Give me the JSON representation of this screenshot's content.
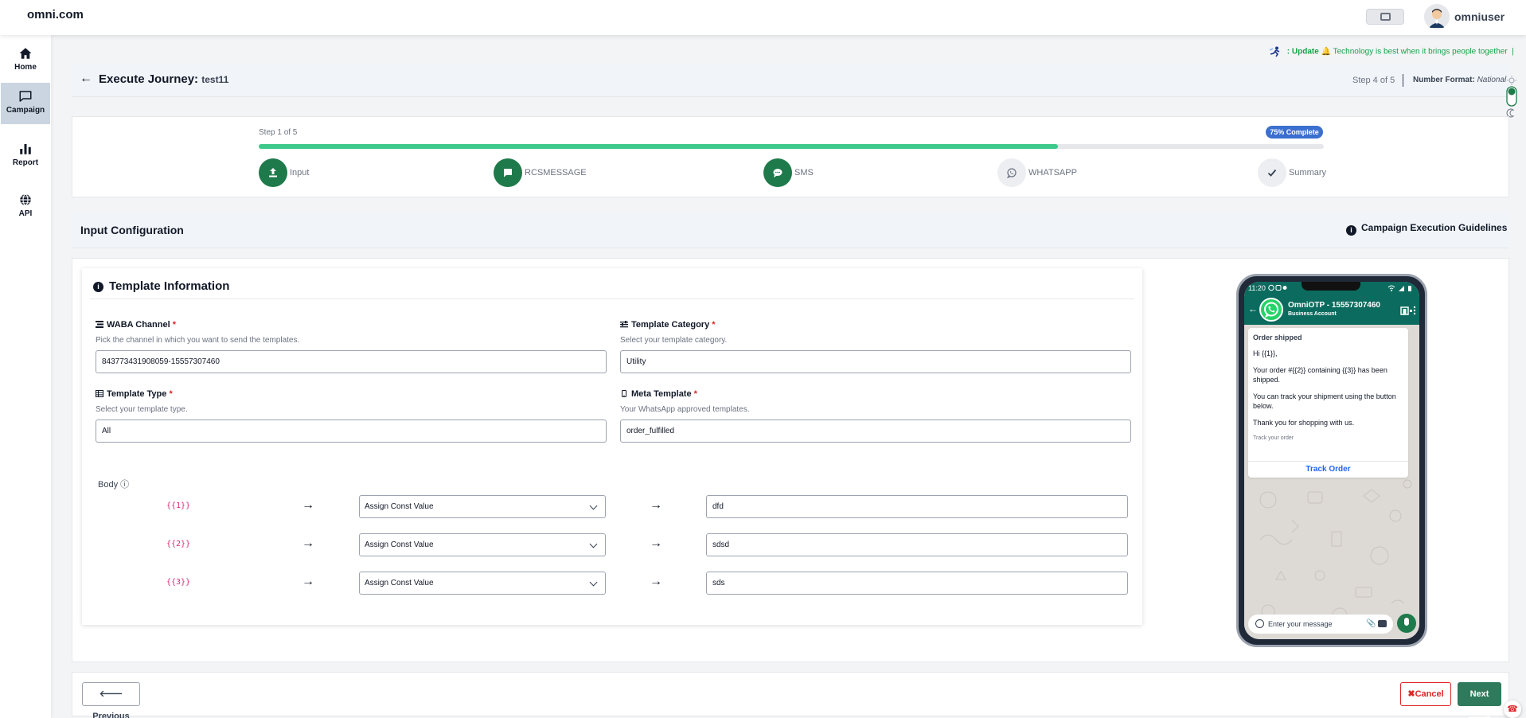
{
  "topbar": {
    "brand": "omni.com",
    "username": "omniuser"
  },
  "sidebar": {
    "items": [
      {
        "label": "Home",
        "icon": "home-icon"
      },
      {
        "label": "Campaign",
        "icon": "chat-icon",
        "active": true
      },
      {
        "label": "Report",
        "icon": "bar-chart-icon"
      },
      {
        "label": "API",
        "icon": "globe-icon"
      }
    ]
  },
  "tagline": {
    "update": ": Update",
    "text": "Technology is best when it brings people together"
  },
  "header": {
    "title": "Execute Journey:",
    "journey_name": "test11",
    "step_of": "Step 4 of 5",
    "number_format_label": "Number Format:",
    "number_format_value": "National"
  },
  "stepper": {
    "step_label": "Step 1 of 5",
    "percent_label": "75% Complete",
    "progress": 0.75,
    "steps": [
      {
        "label": "Input",
        "done": true
      },
      {
        "label": "RCSMESSAGE",
        "done": true
      },
      {
        "label": "SMS",
        "done": true
      },
      {
        "label": "WHATSAPP",
        "done": false
      },
      {
        "label": "Summary",
        "done": false
      }
    ]
  },
  "config": {
    "title": "Input Configuration",
    "guidelines": "Campaign Execution Guidelines"
  },
  "template": {
    "title": "Template Information",
    "fields": {
      "waba": {
        "label": "WABA Channel",
        "required": "*",
        "hint": "Pick the channel in which you want to send the templates.",
        "value": "843773431908059-15557307460"
      },
      "category": {
        "label": "Template Category",
        "required": "*",
        "hint": "Select your template category.",
        "value": "Utility"
      },
      "type": {
        "label": "Template Type",
        "required": "*",
        "hint": "Select your template type.",
        "value": "All"
      },
      "meta": {
        "label": "Meta Template",
        "required": "*",
        "hint": "Your WhatsApp approved templates.",
        "value": "order_fulfilled"
      }
    },
    "body_label": "Body ⓘ",
    "arrow": "→",
    "variables": [
      {
        "token": "{{1}}",
        "mode": "Assign Const Value",
        "value": "dfd"
      },
      {
        "token": "{{2}}",
        "mode": "Assign Const Value",
        "value": "sdsd"
      },
      {
        "token": "{{3}}",
        "mode": "Assign Const Value",
        "value": "sds"
      }
    ]
  },
  "phone": {
    "time": "11:20",
    "contact_name": "OmniOTP - 15557307460",
    "contact_sub": "Business Account",
    "message": {
      "title": "Order shipped",
      "lines": [
        "Hi {{1}},",
        "Your order #{{2}} containing {{3}} has been shipped.",
        "You can track your shipment using the button below.",
        "Thank you for shopping with us."
      ],
      "footer": "Track your order",
      "button": "Track Order"
    },
    "compose_placeholder": "Enter your message"
  },
  "footer": {
    "previous": "Previous",
    "cancel": "Cancel",
    "next": "Next"
  },
  "colors": {
    "primary_green": "#1e7a4a",
    "progress": "#3ec98b",
    "badge": "#3b6fd0",
    "danger": "#dc2626",
    "whatsapp_header": "#0b6b5e"
  }
}
